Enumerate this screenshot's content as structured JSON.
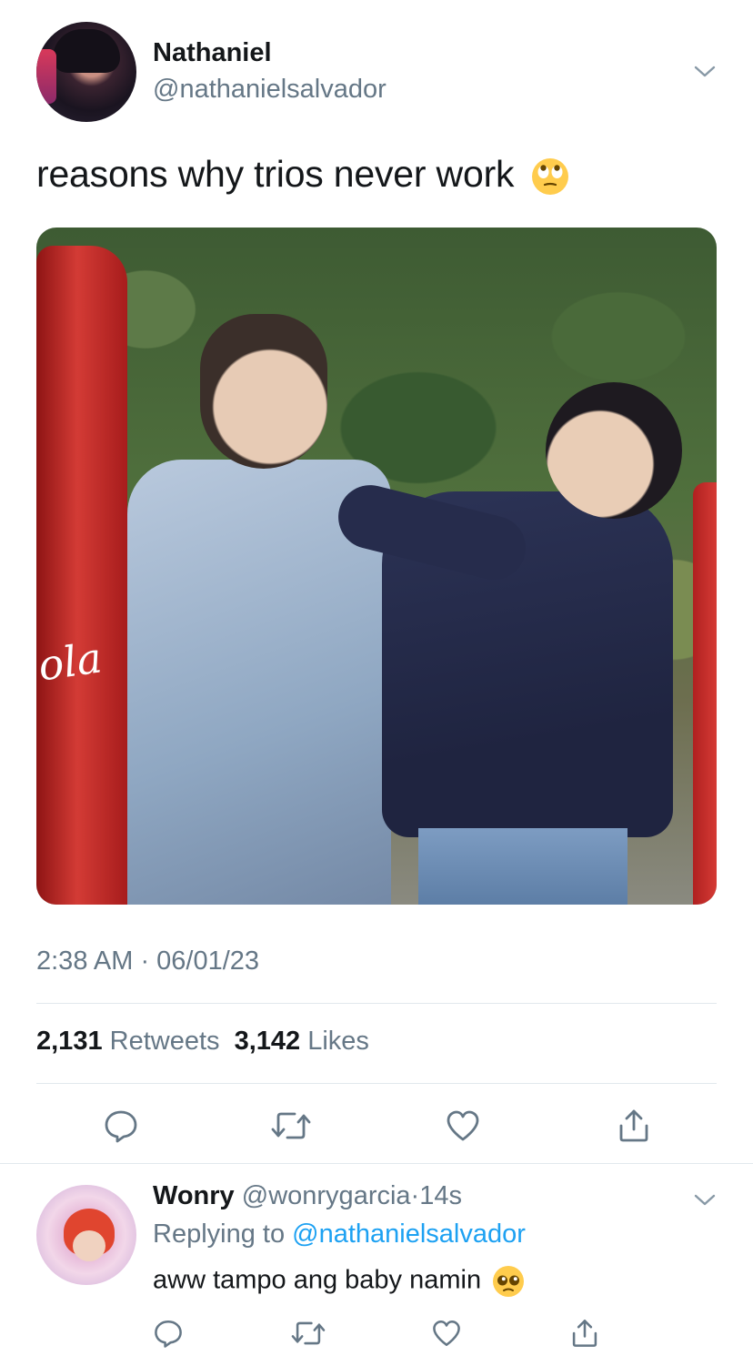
{
  "tweet": {
    "author_name": "Nathaniel",
    "author_handle": "@nathanielsalvador",
    "text": "reasons why trios never work",
    "text_emoji": "face-with-rolling-eyes",
    "photo_text": "ola",
    "timestamp": "2:38 AM · 06/01/23",
    "retweets_count": "2,131",
    "retweets_label": "Retweets",
    "likes_count": "3,142",
    "likes_label": "Likes"
  },
  "reply": {
    "author_name": "Wonry",
    "author_handle": "@wonrygarcia",
    "separator": "·",
    "time_ago": "14s",
    "replying_to_label": "Replying to",
    "replying_to_handle": "@nathanielsalvador",
    "text": "aww tampo ang baby namin",
    "text_emoji": "pleading-face"
  },
  "actions": [
    "reply-icon",
    "retweet-icon",
    "like-icon",
    "share-icon"
  ],
  "colors": {
    "text_primary": "#14171a",
    "text_secondary": "#657786",
    "link": "#1da1f2",
    "divider": "#e1e8ed",
    "icon": "#657786"
  }
}
